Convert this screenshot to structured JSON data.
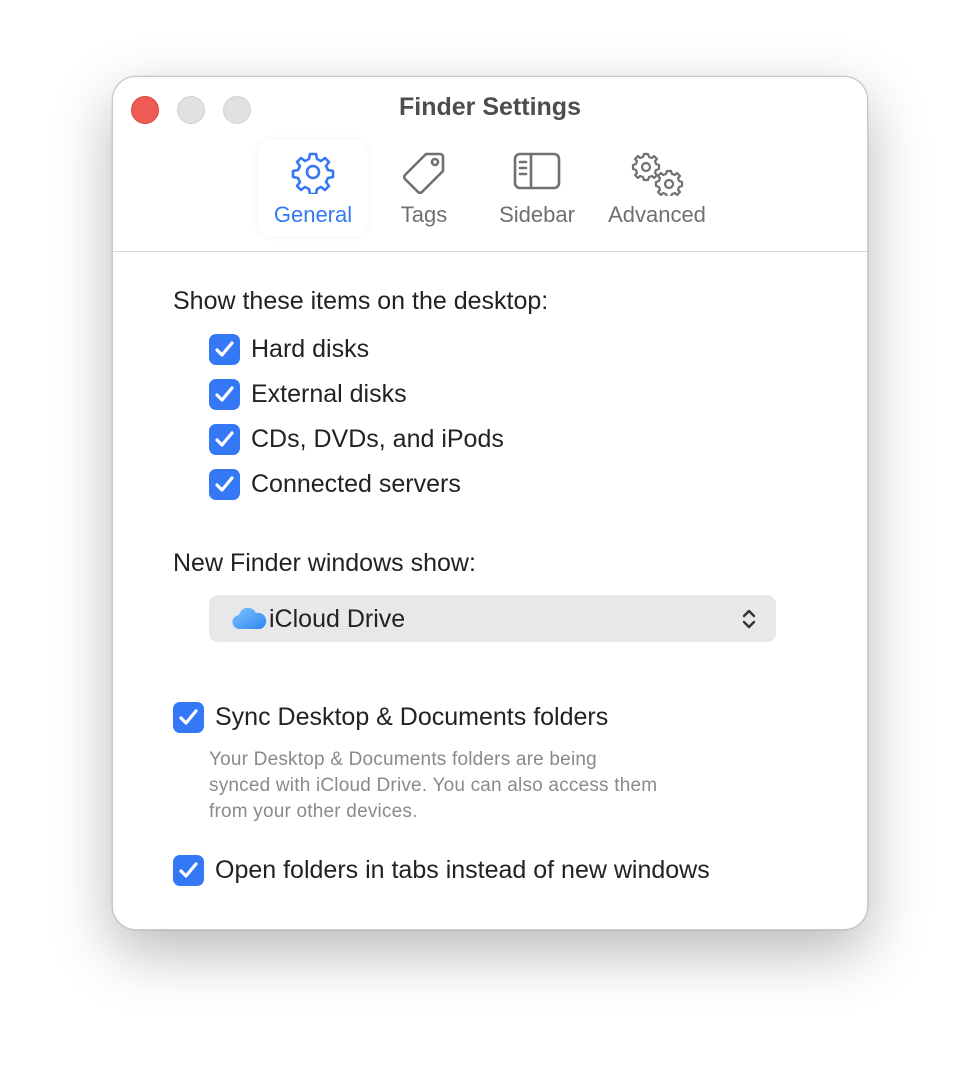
{
  "window": {
    "title": "Finder Settings"
  },
  "toolbar": {
    "tabs": [
      {
        "label": "General",
        "icon": "gear-icon",
        "selected": true
      },
      {
        "label": "Tags",
        "icon": "tag-icon",
        "selected": false
      },
      {
        "label": "Sidebar",
        "icon": "sidebar-icon",
        "selected": false
      },
      {
        "label": "Advanced",
        "icon": "gears-icon",
        "selected": false
      }
    ]
  },
  "desktop_items": {
    "heading": "Show these items on the desktop:",
    "items": [
      {
        "label": "Hard disks",
        "checked": true
      },
      {
        "label": "External disks",
        "checked": true
      },
      {
        "label": "CDs, DVDs, and iPods",
        "checked": true
      },
      {
        "label": "Connected servers",
        "checked": true
      }
    ]
  },
  "new_windows": {
    "label": "New Finder windows show:",
    "value": "iCloud Drive",
    "icon": "icloud-icon"
  },
  "sync": {
    "label": "Sync Desktop & Documents folders",
    "checked": true,
    "description": [
      "Your Desktop & Documents folders are being",
      "synced with iCloud Drive. You can also access them",
      "from your other devices."
    ]
  },
  "tabs_option": {
    "label": "Open folders in tabs instead of new windows",
    "checked": true
  },
  "colors": {
    "accent": "#3478f6",
    "close": "#ee5b55"
  }
}
